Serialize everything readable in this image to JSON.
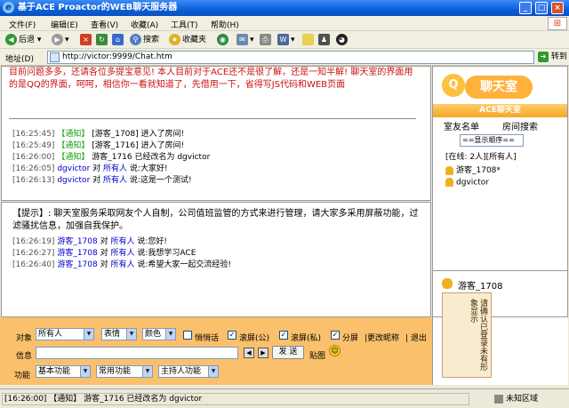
{
  "window": {
    "title": "基于ACE Proactor的WEB聊天服务器"
  },
  "menu": [
    "文件(F)",
    "编辑(E)",
    "查看(V)",
    "收藏(A)",
    "工具(T)",
    "帮助(H)"
  ],
  "toolbar": {
    "back": "后退",
    "search": "搜索",
    "favorites": "收藏夹"
  },
  "address": {
    "label": "地址(D)",
    "url": "http://victor:9999/Chat.htm",
    "go": "转到"
  },
  "chat_top": {
    "intro": "目前问题多多，还请各位多提宝意见! 本人目前对于ACE还不是很了解，还是一知半解! 聊天室的界面用的是QQ的界面，呵呵，相信你一看就知道了，先借用一下，省得写JS代码和WEB页面",
    "lines": [
      {
        "time": "[16:25:45]",
        "tag": "【通知】",
        "text": "[游客_1708] 进入了房间!"
      },
      {
        "time": "[16:25:49]",
        "tag": "【通知】",
        "text": "[游客_1716] 进入了房间!"
      },
      {
        "time": "[16:26:00]",
        "tag": "【通知】",
        "text": "游客_1716 已经改名为 dgvictor"
      },
      {
        "time": "[16:26:05]",
        "who": "dgvictor",
        "mid": "对",
        "to": "所有人",
        "text": "说:大家好!"
      },
      {
        "time": "[16:26:13]",
        "who": "dgvictor",
        "mid": "对",
        "to": "所有人",
        "text": "说:这是一个测试!"
      }
    ]
  },
  "chat_bottom": {
    "tip": "【提示】: 聊天室服务采取网友个人自制，公司值班监管的方式来进行管理，请大家多采用屏蔽功能，过滤骚扰信息，加强自我保护。",
    "lines": [
      {
        "time": "[16:26:19]",
        "who": "游客_1708",
        "mid": "对",
        "to": "所有人",
        "text": "说:您好!"
      },
      {
        "time": "[16:26:27]",
        "who": "游客_1708",
        "mid": "对",
        "to": "所有人",
        "text": "说:我想学习ACE"
      },
      {
        "time": "[16:26:40]",
        "who": "游客_1708",
        "mid": "对",
        "to": "所有人",
        "text": "说:希望大家一起交流经验!"
      }
    ]
  },
  "sidebar": {
    "logo_text": "聊天室",
    "title": "ACE聊天室",
    "tab_friends": "室友名单",
    "tab_search": "房间搜索",
    "order": "==显示顺序==",
    "online": "[在线: 2人][所有人]",
    "users": [
      "游客_1708*",
      "dgvictor"
    ],
    "profile_name": "游客_1708",
    "profile_image_text": "请确认已登录未有形象显示"
  },
  "controls": {
    "target_label": "对象",
    "target_value": "所有人",
    "emotion": "表情",
    "color": "颜色",
    "whisper": "悄悄话",
    "scroll_public": "滚屏(公)",
    "scroll_private": "滚屏(私)",
    "split": "分屏",
    "rename": "|更改昵称",
    "exit": "| 退出",
    "message_label": "信息",
    "send": "发 送",
    "paste": "贴图",
    "function_label": "功能",
    "basic": "基本功能",
    "common": "常用功能",
    "host": "主持人功能"
  },
  "status": {
    "text": "[16:26:00] 【通知】 游客_1716 已经改名为 dgvictor",
    "zone": "未知区域"
  }
}
